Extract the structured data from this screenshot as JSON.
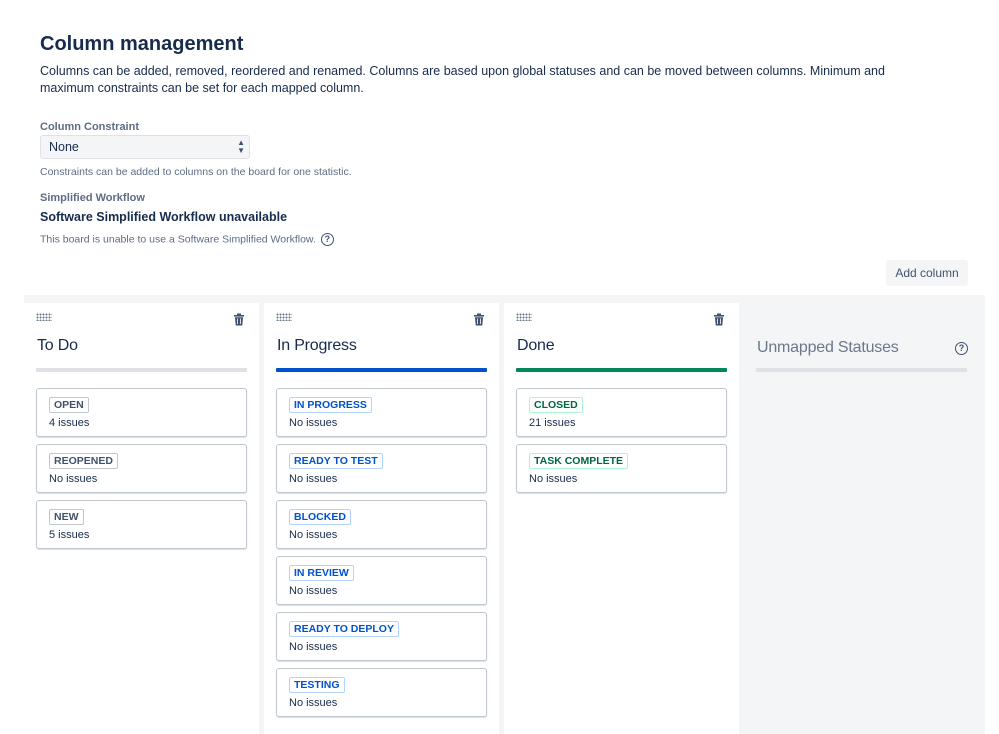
{
  "header": {
    "title": "Column management",
    "description": "Columns can be added, removed, reordered and renamed. Columns are based upon global statuses and can be moved between columns. Minimum and maximum constraints can be set for each mapped column."
  },
  "constraint": {
    "label": "Column Constraint",
    "selected": "None",
    "helper": "Constraints can be added to columns on the board for one statistic."
  },
  "simplified": {
    "label": "Simplified Workflow",
    "title": "Software Simplified Workflow unavailable",
    "helper": "This board is unable to use a Software Simplified Workflow."
  },
  "actions": {
    "add_column": "Add column"
  },
  "icons": {
    "drag": "drag-handle-icon",
    "trash": "trash-icon",
    "help": "help-icon",
    "select": "chevron-up-down-icon"
  },
  "colors": {
    "todo": "#dfe1e6",
    "in_progress": "#0052cc",
    "done": "#00875a"
  },
  "columns": [
    {
      "title": "To Do",
      "statuses": [
        {
          "name": "OPEN",
          "issues": "4 issues"
        },
        {
          "name": "REOPENED",
          "issues": "No issues"
        },
        {
          "name": "NEW",
          "issues": "5 issues"
        }
      ]
    },
    {
      "title": "In Progress",
      "statuses": [
        {
          "name": "IN PROGRESS",
          "issues": "No issues"
        },
        {
          "name": "READY TO TEST",
          "issues": "No issues"
        },
        {
          "name": "BLOCKED",
          "issues": "No issues"
        },
        {
          "name": "IN REVIEW",
          "issues": "No issues"
        },
        {
          "name": "READY TO DEPLOY",
          "issues": "No issues"
        },
        {
          "name": "TESTING",
          "issues": "No issues"
        }
      ]
    },
    {
      "title": "Done",
      "statuses": [
        {
          "name": "CLOSED",
          "issues": "21 issues"
        },
        {
          "name": "TASK COMPLETE",
          "issues": "No issues"
        }
      ]
    }
  ],
  "unmapped": {
    "title": "Unmapped Statuses"
  }
}
